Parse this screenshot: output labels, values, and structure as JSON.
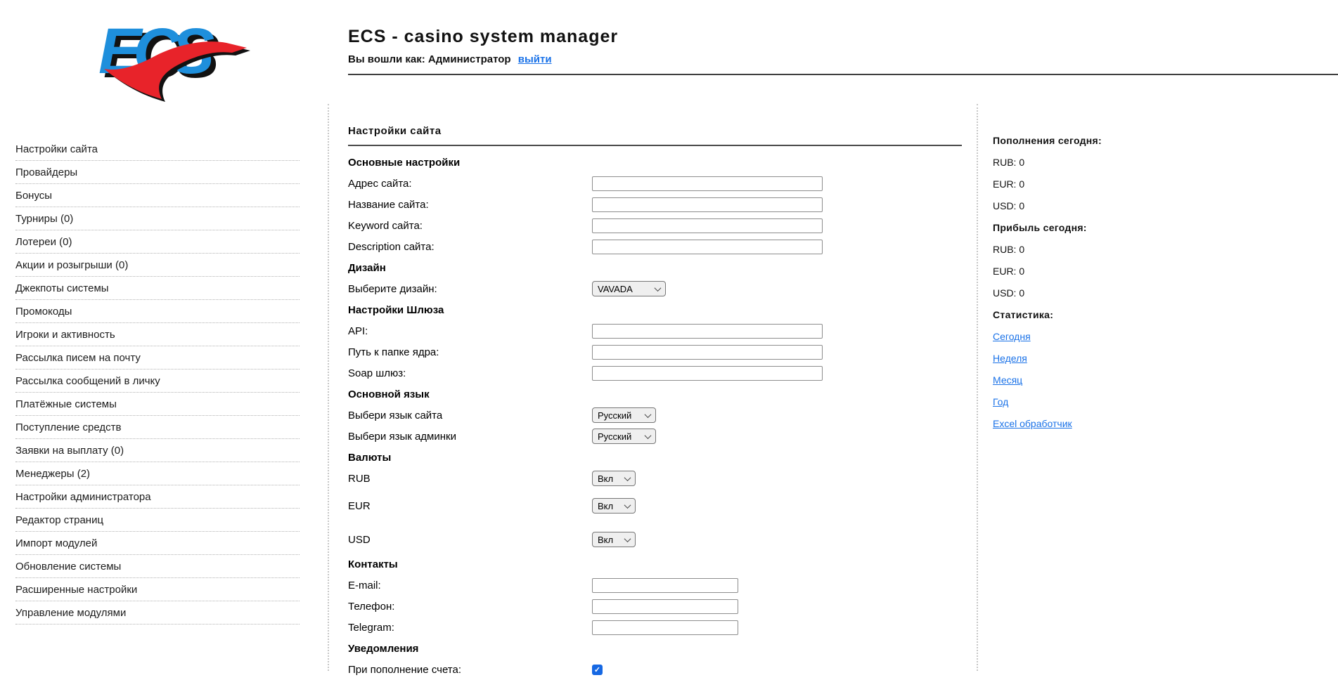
{
  "colors": {
    "logo_blue": "#1e8fdc",
    "logo_red": "#e8232a",
    "link_blue": "#1a72e8",
    "checkbox_blue": "#1668e3"
  },
  "header": {
    "logo_text": "ECS",
    "title": "ECS - casino system manager",
    "login_prefix": "Вы вошли как: Администратор",
    "logout_label": "выйти"
  },
  "sidebar": {
    "items": [
      "Настройки сайта",
      "Провайдеры",
      "Бонусы",
      "Турниры (0)",
      "Лотереи (0)",
      "Акции и розыгрыши (0)",
      "Джекпоты системы",
      "Промокоды",
      "Игроки и активность",
      "Рассылка писем на почту",
      "Рассылка сообщений в личку",
      "Платёжные системы",
      "Поступление средств",
      "Заявки на выплату (0)",
      "Менеджеры (2)",
      "Настройки администратора",
      "Редактор страниц",
      "Импорт модулей",
      "Обновление системы",
      "Расширенные настройки",
      "Управление модулями"
    ]
  },
  "main": {
    "title": "Настройки сайта",
    "rows": [
      {
        "type": "heading",
        "name": "basic-settings-heading",
        "label": "Основные настройки"
      },
      {
        "type": "text",
        "name": "site-address",
        "label": "Адрес сайта:",
        "value": "",
        "width": "wide"
      },
      {
        "type": "text",
        "name": "site-name",
        "label": "Название сайта:",
        "value": "",
        "width": "wide"
      },
      {
        "type": "text",
        "name": "site-keyword",
        "label": "Keyword сайта:",
        "value": "",
        "width": "wide"
      },
      {
        "type": "text",
        "name": "site-description",
        "label": "Description сайта:",
        "value": "",
        "width": "wide"
      },
      {
        "type": "heading",
        "name": "design-heading",
        "label": "Дизайн"
      },
      {
        "type": "select",
        "name": "design",
        "label": "Выберите дизайн:",
        "value": "VAVADA",
        "size": "lg"
      },
      {
        "type": "heading",
        "name": "gateway-heading",
        "label": "Настройки Шлюза"
      },
      {
        "type": "text",
        "name": "api",
        "label": "API:",
        "value": "",
        "width": "wide"
      },
      {
        "type": "text",
        "name": "core-folder-path",
        "label": "Путь к папке ядра:",
        "value": "",
        "width": "wide"
      },
      {
        "type": "text",
        "name": "soap-gateway",
        "label": "Soap шлюз:",
        "value": "",
        "width": "wide"
      },
      {
        "type": "heading",
        "name": "main-language-heading",
        "label": "Основной язык"
      },
      {
        "type": "select",
        "name": "site-language",
        "label": "Выбери язык сайта",
        "value": "Русский",
        "size": "md"
      },
      {
        "type": "select",
        "name": "admin-language",
        "label": "Выбери язык админки",
        "value": "Русский",
        "size": "md"
      },
      {
        "type": "heading",
        "name": "currencies-heading",
        "label": "Валюты"
      },
      {
        "type": "select",
        "name": "currency-rub",
        "label": "RUB",
        "value": "Вкл",
        "size": "sm"
      },
      {
        "type": "select",
        "name": "currency-eur",
        "label": "EUR",
        "value": "Вкл",
        "size": "sm"
      },
      {
        "type": "select",
        "name": "currency-usd",
        "label": "USD",
        "value": "Вкл",
        "size": "sm"
      },
      {
        "type": "heading",
        "name": "contacts-heading",
        "label": "Контакты"
      },
      {
        "type": "text",
        "name": "email",
        "label": "E-mail:",
        "value": "",
        "width": "narrow"
      },
      {
        "type": "text",
        "name": "phone",
        "label": "Телефон:",
        "value": "",
        "width": "narrow"
      },
      {
        "type": "text",
        "name": "telegram",
        "label": "Telegram:",
        "value": "",
        "width": "narrow"
      },
      {
        "type": "heading",
        "name": "notifications-heading",
        "label": "Уведомления"
      },
      {
        "type": "checkbox",
        "name": "notify-on-deposit",
        "label": "При пополнение счета:",
        "checked": true
      }
    ]
  },
  "right_panel": {
    "deposits_title": "Пополнения сегодня:",
    "deposits": [
      {
        "label": "RUB",
        "value": "0"
      },
      {
        "label": "EUR",
        "value": "0"
      },
      {
        "label": "USD",
        "value": "0"
      }
    ],
    "profit_title": "Прибыль сегодня:",
    "profit": [
      {
        "label": "RUB",
        "value": "0"
      },
      {
        "label": "EUR",
        "value": "0"
      },
      {
        "label": "USD",
        "value": "0"
      }
    ],
    "stats_title": "Статистика:",
    "stats_links": [
      {
        "name": "stats-link-today",
        "label": "Сегодня"
      },
      {
        "name": "stats-link-week",
        "label": "Неделя"
      },
      {
        "name": "stats-link-month",
        "label": "Месяц"
      },
      {
        "name": "stats-link-year",
        "label": "Год"
      },
      {
        "name": "excel-handler-link",
        "label": "Excel обработчик"
      }
    ]
  }
}
